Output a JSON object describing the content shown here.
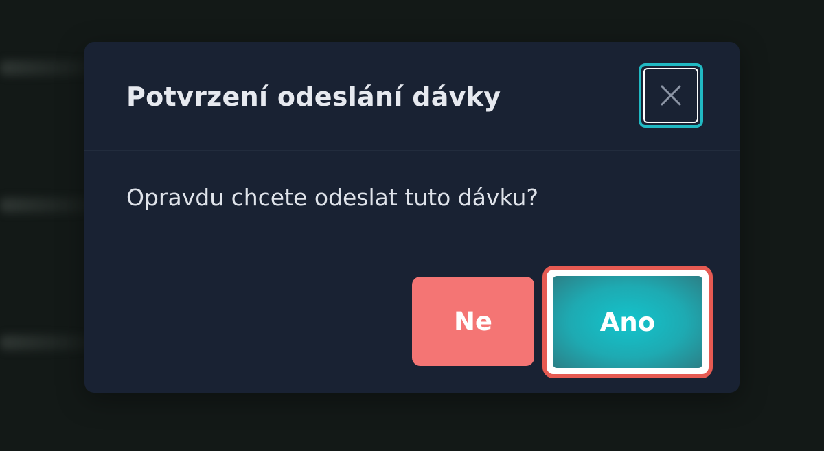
{
  "dialog": {
    "title": "Potvrzení odeslání dávky",
    "message": "Opravdu chcete odeslat tuto dávku?",
    "close_icon": "close-icon",
    "buttons": {
      "no_label": "Ne",
      "yes_label": "Ano"
    }
  },
  "colors": {
    "dialog_background": "#192233",
    "page_backdrop": "#131917",
    "no_button": "#f47574",
    "yes_button": "#13c4cc",
    "focus_ring_close": "#21b9c3",
    "focus_ring_yes": "#e65a52"
  }
}
